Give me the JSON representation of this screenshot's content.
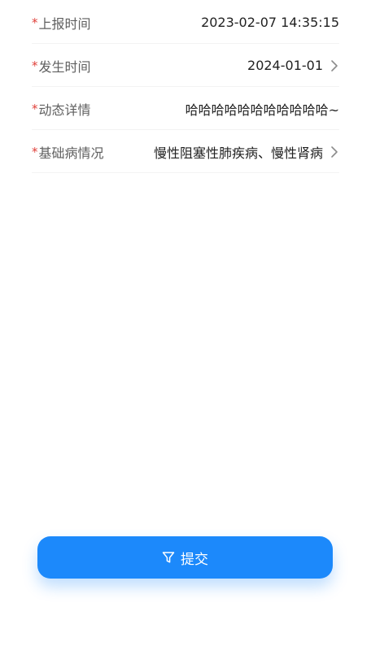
{
  "form": {
    "rows": [
      {
        "label": "上报时间",
        "value": "2023-02-07 14:35:15",
        "chevron": false
      },
      {
        "label": "发生时间",
        "value": "2024-01-01",
        "chevron": true
      },
      {
        "label": "动态详情",
        "value": "哈哈哈哈哈哈哈哈哈哈哈~",
        "chevron": false
      },
      {
        "label": "基础病情况",
        "value": "慢性阻塞性肺疾病、慢性肾病",
        "chevron": true
      }
    ],
    "required_mark": "*"
  },
  "submit": {
    "label": "提交",
    "icon": "filter-icon"
  },
  "colors": {
    "primary": "#1c89fb",
    "required": "#e0403a",
    "label": "#5f5f5f",
    "value": "#222222"
  }
}
